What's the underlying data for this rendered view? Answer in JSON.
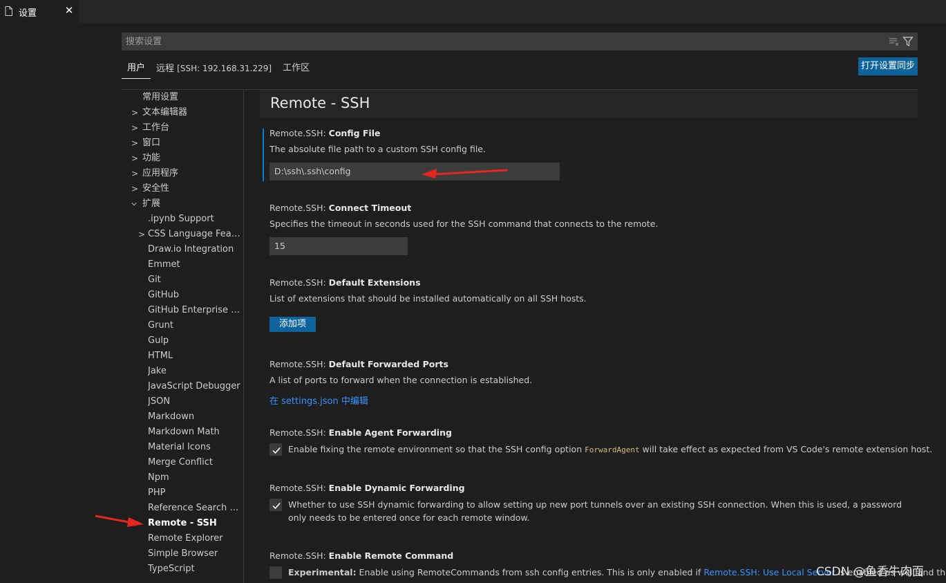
{
  "tab": {
    "label": "设置",
    "close": "✕"
  },
  "search": {
    "placeholder": "搜索设置"
  },
  "scopes": {
    "user": "用户",
    "remote": "远程",
    "remote_detail": "[SSH: 192.168.31.229]",
    "workspace": "工作区"
  },
  "sync_button": "打开设置同步",
  "toc": {
    "common": "常用设置",
    "text_editor": "文本编辑器",
    "workbench": "工作台",
    "window": "窗口",
    "features": "功能",
    "application": "应用程序",
    "security": "安全性",
    "extensions": "扩展",
    "ext_items": [
      ".ipynb Support",
      "CSS Language Features",
      "Draw.io Integration",
      "Emmet",
      "Git",
      "GitHub",
      "GitHub Enterprise Ser...",
      "Grunt",
      "Gulp",
      "HTML",
      "Jake",
      "JavaScript Debugger",
      "JSON",
      "Markdown",
      "Markdown Math",
      "Material Icons",
      "Merge Conflict",
      "Npm",
      "PHP",
      "Reference Search View",
      "Remote - SSH",
      "Remote Explorer",
      "Simple Browser",
      "TypeScript"
    ]
  },
  "section_title": "Remote - SSH",
  "settings": {
    "config_file": {
      "category": "Remote.SSH: ",
      "name": "Config File",
      "desc": "The absolute file path to a custom SSH config file.",
      "value": "D:\\ssh\\.ssh\\config"
    },
    "connect_timeout": {
      "category": "Remote.SSH: ",
      "name": "Connect Timeout",
      "desc": "Specifies the timeout in seconds used for the SSH command that connects to the remote.",
      "value": "15"
    },
    "default_extensions": {
      "category": "Remote.SSH: ",
      "name": "Default Extensions",
      "desc": "List of extensions that should be installed automatically on all SSH hosts.",
      "button": "添加项"
    },
    "default_ports": {
      "category": "Remote.SSH: ",
      "name": "Default Forwarded Ports",
      "desc": "A list of ports to forward when the connection is established.",
      "link": "在 settings.json 中编辑"
    },
    "agent_forwarding": {
      "category": "Remote.SSH: ",
      "name": "Enable Agent Forwarding",
      "desc_before": "Enable fixing the remote environment so that the SSH config option ",
      "code": "ForwardAgent",
      "desc_after": " will take effect as expected from VS Code's remote extension host.",
      "checked": true
    },
    "dynamic_forwarding": {
      "category": "Remote.SSH: ",
      "name": "Enable Dynamic Forwarding",
      "desc": "Whether to use SSH dynamic forwarding to allow setting up new port tunnels over an existing SSH connection. When this is used, a password only needs to be entered once for each remote window.",
      "checked": true
    },
    "remote_command": {
      "category": "Remote.SSH: ",
      "name": "Enable Remote Command",
      "desc_bold": "Experimental:",
      "desc_before": " Enable using RemoteCommands from ssh config entries. This is only enabled if ",
      "desc_link": "Remote.SSH: Use Local Server",
      "desc_after": " is enabled as well and the",
      "checked": false
    }
  },
  "watermark": "CSDN @鱼香牛肉面",
  "colors": {
    "accent": "#0e639c",
    "link": "#3794ff",
    "focus": "#007fd4",
    "arrow": "#e8261d"
  }
}
